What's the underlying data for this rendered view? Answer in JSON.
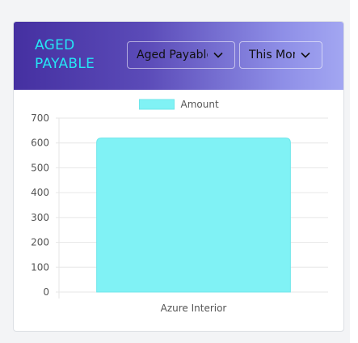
{
  "widget": {
    "title_line1": "AGED",
    "title_line2": "PAYABLE",
    "type_dropdown": {
      "selected": "Aged Payable"
    },
    "period_dropdown": {
      "selected": "This Month"
    }
  },
  "colors": {
    "title": "#25e6f5",
    "bar_fill": "#80f2f5",
    "bar_stroke": "#6fe6ea",
    "grid": "#e6e6e6",
    "tick_text": "#555555"
  },
  "icons": {
    "dropdown": "chevron-down-icon"
  },
  "chart_data": {
    "type": "bar",
    "categories": [
      "Azure Interior"
    ],
    "series": [
      {
        "name": "Amount",
        "values": [
          620
        ]
      }
    ],
    "ylim": [
      0,
      700
    ],
    "yticks": [
      0,
      100,
      200,
      300,
      400,
      500,
      600,
      700
    ],
    "grid": true,
    "legend": "top-center"
  }
}
